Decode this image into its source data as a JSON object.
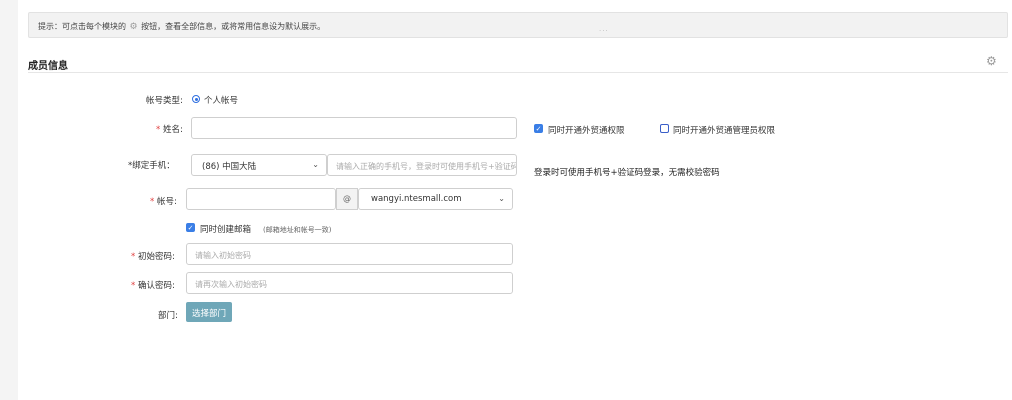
{
  "tip": {
    "prefix": "提示：可点击每个模块的",
    "suffix": "按钮，查看全部信息，或将常用信息设为默认展示。",
    "dots": "..."
  },
  "section": {
    "title": "成员信息"
  },
  "form": {
    "account_type": {
      "label": "帐号类型:",
      "option": "个人帐号"
    },
    "name": {
      "label": "姓名:",
      "value": ""
    },
    "foreign_trade": {
      "label": "同时开通外贸通权限",
      "checked": true
    },
    "foreign_trade_admin": {
      "label": "同时开通外贸通管理员权限",
      "checked": false
    },
    "phone": {
      "label": "*绑定手机：",
      "country": "(86) 中国大陆",
      "placeholder": "请输入正确的手机号，登录时可使用手机号+验证码",
      "hint": "登录时可使用手机号+验证码登录，无需校验密码"
    },
    "account": {
      "label": "帐号:",
      "value": "",
      "at": "@",
      "domain": "wangyi.ntesmall.com"
    },
    "create_mailbox": {
      "label": "同时创建邮箱",
      "note": "(邮箱地址和帐号一致)",
      "checked": true
    },
    "init_password": {
      "label": "初始密码:",
      "placeholder": "请输入初始密码"
    },
    "confirm_password": {
      "label": "确认密码:",
      "placeholder": "请再次输入初始密码"
    },
    "department": {
      "label": "部门:",
      "button": "选择部门"
    }
  },
  "required_mark": "*"
}
